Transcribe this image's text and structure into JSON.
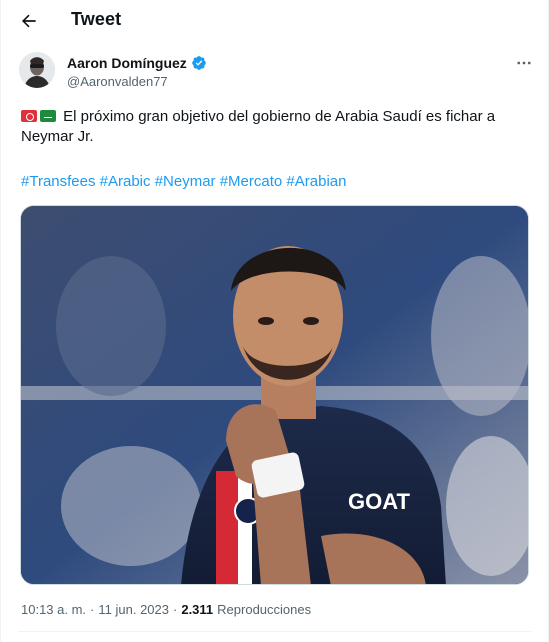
{
  "header": {
    "title": "Tweet",
    "back_icon": "arrow-left-icon"
  },
  "author": {
    "name": "Aaron Domínguez",
    "handle": "@Aaronvalden77",
    "verified": true,
    "verified_color": "#1d9bf0",
    "more_icon": "more-horizontal-icon"
  },
  "tweet": {
    "text": "El próximo gran objetivo del gobierno de Arabia Saudí es fichar a Neymar Jr.",
    "hashtags": [
      "#Transfees",
      "#Arabic",
      "#Neymar",
      "#Mercato",
      "#Arabian"
    ],
    "image_text": "GOAT"
  },
  "meta": {
    "time": "10:13 a. m.",
    "separator": "·",
    "date": "11 jun. 2023",
    "views_count": "2.311",
    "views_label": "Reproducciones"
  },
  "colors": {
    "link": "#1d9bf0",
    "secondary_text": "#536471",
    "primary_text": "#0f1419"
  }
}
